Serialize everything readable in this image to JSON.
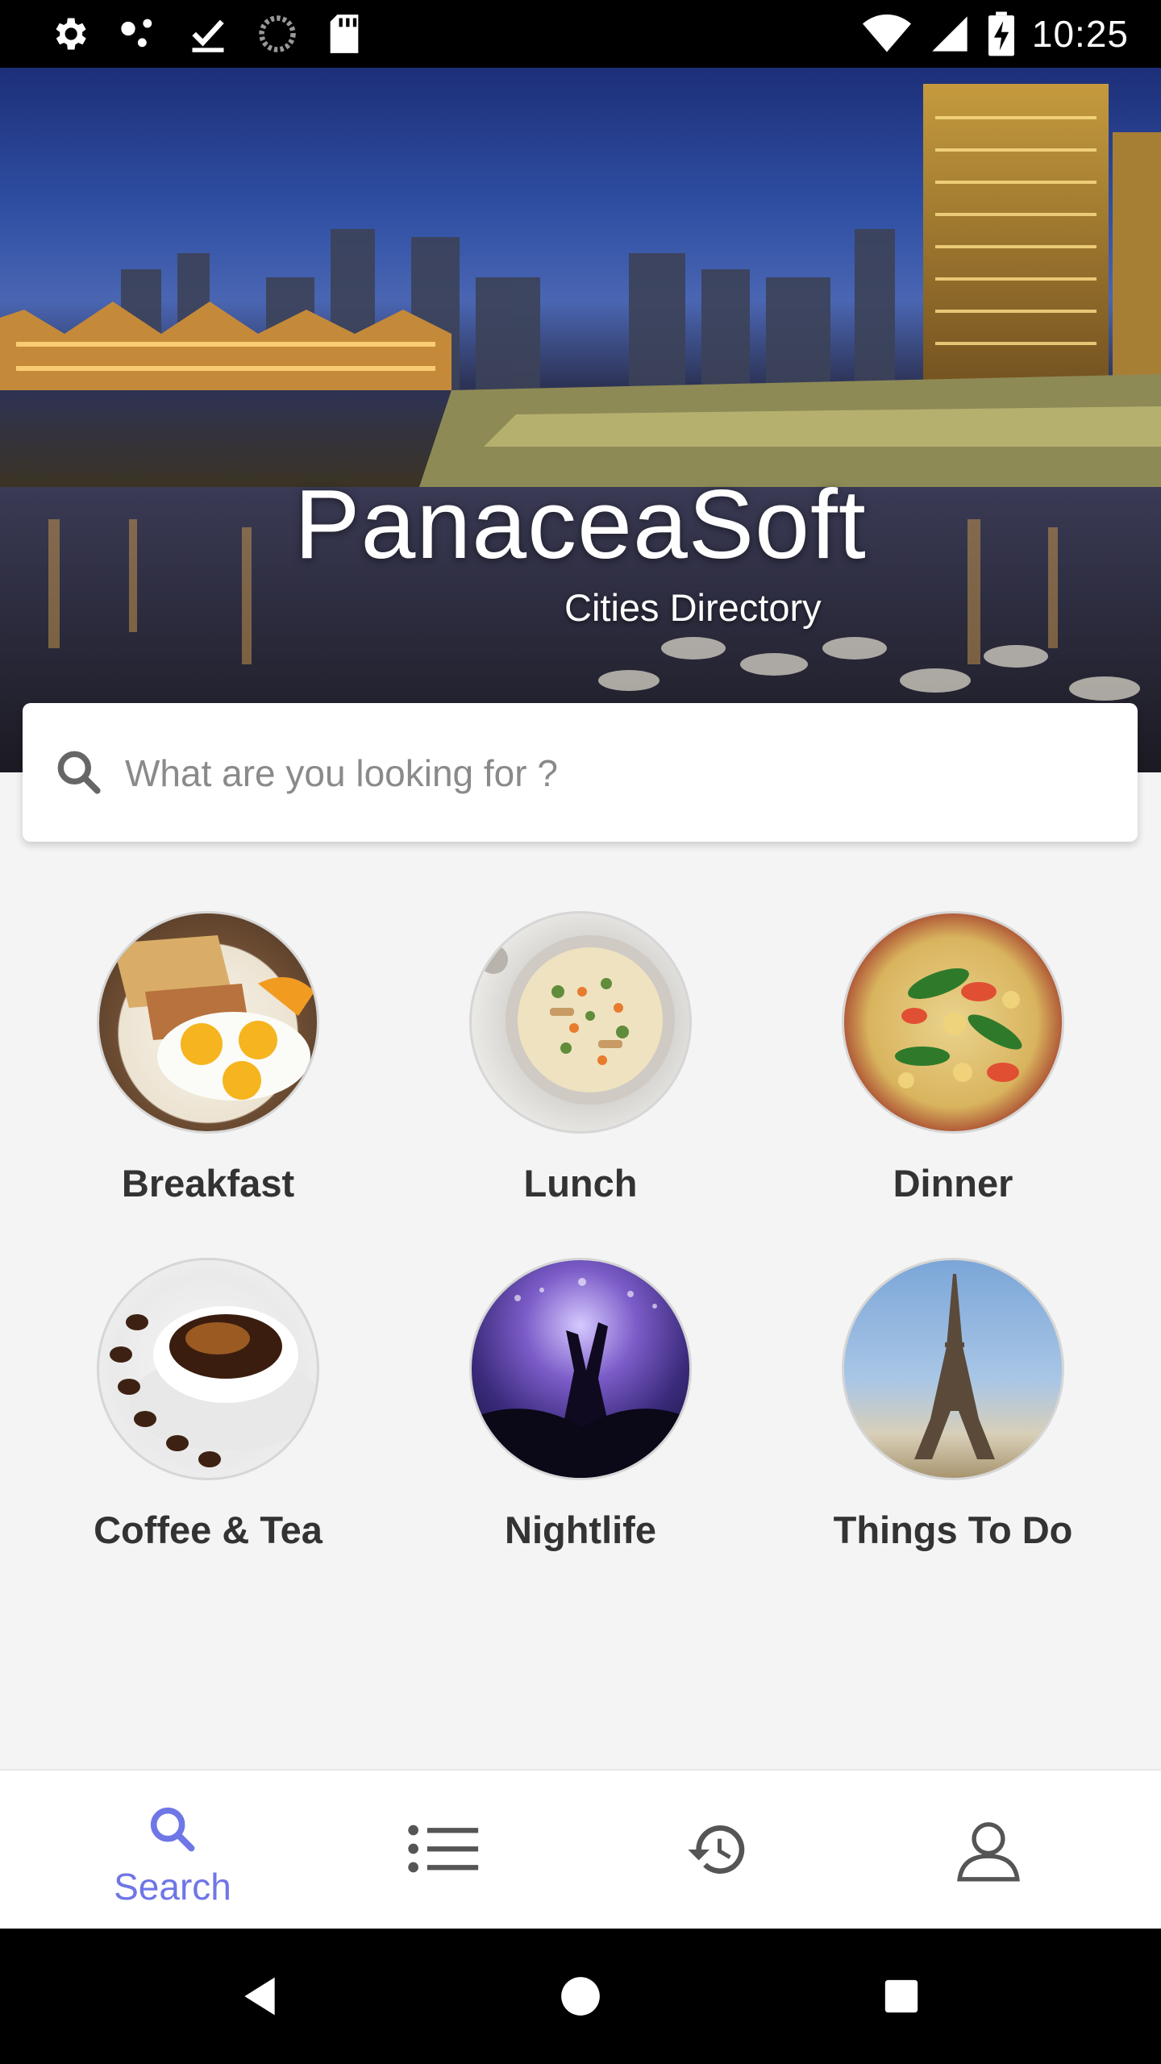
{
  "status_bar": {
    "time": "10:25",
    "left_icons": [
      "settings-icon",
      "dots-icon",
      "check-download-icon",
      "circle-progress-icon",
      "sd-card-icon"
    ],
    "right_icons": [
      "wifi-icon",
      "signal-icon",
      "battery-charging-icon"
    ]
  },
  "hero": {
    "title": "PanaceaSoft",
    "subtitle": "Cities Directory"
  },
  "search": {
    "placeholder": "What are you looking for ?"
  },
  "categories": [
    {
      "label": "Breakfast"
    },
    {
      "label": "Lunch"
    },
    {
      "label": "Dinner"
    },
    {
      "label": "Coffee & Tea"
    },
    {
      "label": "Nightlife"
    },
    {
      "label": "Things To Do"
    }
  ],
  "bottom_nav": {
    "active_color": "#6f76e6",
    "items": [
      {
        "label": "Search",
        "icon": "search-icon",
        "active": true
      },
      {
        "icon": "list-icon"
      },
      {
        "icon": "history-icon"
      },
      {
        "icon": "profile-icon"
      }
    ]
  },
  "system_nav": {
    "icons": [
      "back-icon",
      "home-icon",
      "recents-icon"
    ]
  }
}
